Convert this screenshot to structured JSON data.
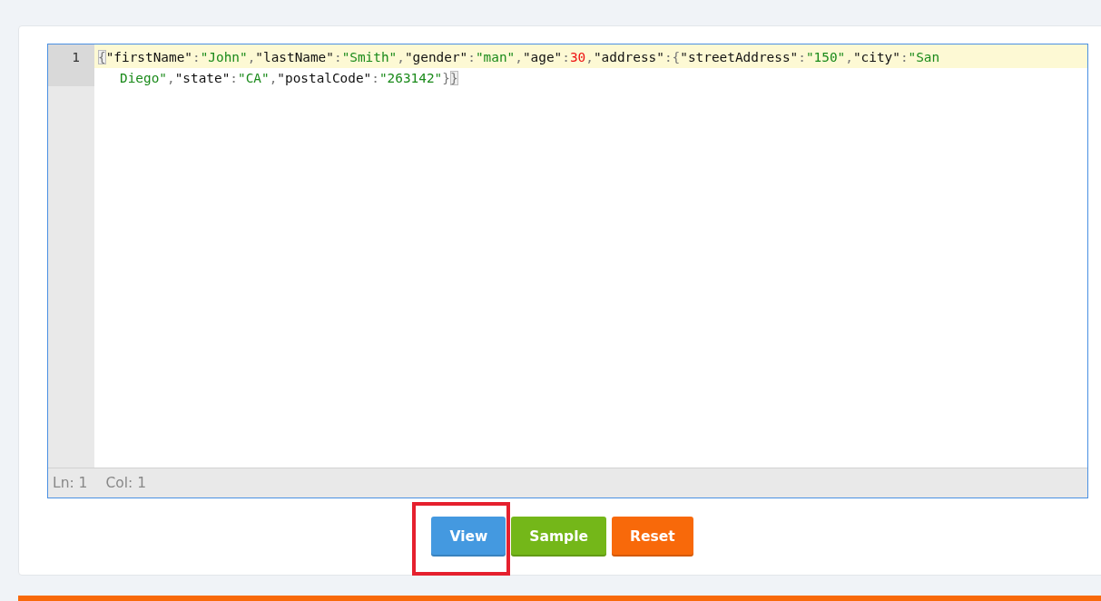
{
  "editor": {
    "line_numbers": [
      "1"
    ],
    "tokens": [
      {
        "kind": "bracket",
        "text": "{"
      },
      {
        "kind": "key",
        "text": "\"firstName\""
      },
      {
        "kind": "punct",
        "text": ":"
      },
      {
        "kind": "string",
        "text": "\"John\""
      },
      {
        "kind": "punct",
        "text": ","
      },
      {
        "kind": "key",
        "text": "\"lastName\""
      },
      {
        "kind": "punct",
        "text": ":"
      },
      {
        "kind": "string",
        "text": "\"Smith\""
      },
      {
        "kind": "punct",
        "text": ","
      },
      {
        "kind": "key",
        "text": "\"gender\""
      },
      {
        "kind": "punct",
        "text": ":"
      },
      {
        "kind": "string",
        "text": "\"man\""
      },
      {
        "kind": "punct",
        "text": ","
      },
      {
        "kind": "key",
        "text": "\"age\""
      },
      {
        "kind": "punct",
        "text": ":"
      },
      {
        "kind": "number",
        "text": "30"
      },
      {
        "kind": "punct",
        "text": ","
      },
      {
        "kind": "key",
        "text": "\"address\""
      },
      {
        "kind": "punct",
        "text": ":{"
      },
      {
        "kind": "key",
        "text": "\"streetAddress\""
      },
      {
        "kind": "punct",
        "text": ":"
      },
      {
        "kind": "string",
        "text": "\"150\""
      },
      {
        "kind": "punct",
        "text": ","
      },
      {
        "kind": "key",
        "text": "\"city\""
      },
      {
        "kind": "punct",
        "text": ":"
      },
      {
        "kind": "string",
        "text": "\"San Diego\""
      },
      {
        "kind": "punct",
        "text": ","
      },
      {
        "kind": "key",
        "text": "\"state\""
      },
      {
        "kind": "punct",
        "text": ":"
      },
      {
        "kind": "string",
        "text": "\"CA\""
      },
      {
        "kind": "punct",
        "text": ","
      },
      {
        "kind": "key",
        "text": "\"postalCode\""
      },
      {
        "kind": "punct",
        "text": ":"
      },
      {
        "kind": "string",
        "text": "\"263142\""
      },
      {
        "kind": "punct",
        "text": "}"
      },
      {
        "kind": "bracket",
        "text": "}"
      }
    ],
    "status": {
      "line": "Ln: 1",
      "column": "Col: 1"
    }
  },
  "buttons": [
    {
      "label": "View",
      "color": "#4499e0",
      "highlighted": true
    },
    {
      "label": "Sample",
      "color": "#74b719",
      "highlighted": false
    },
    {
      "label": "Reset",
      "color": "#f8690a",
      "highlighted": false
    }
  ]
}
